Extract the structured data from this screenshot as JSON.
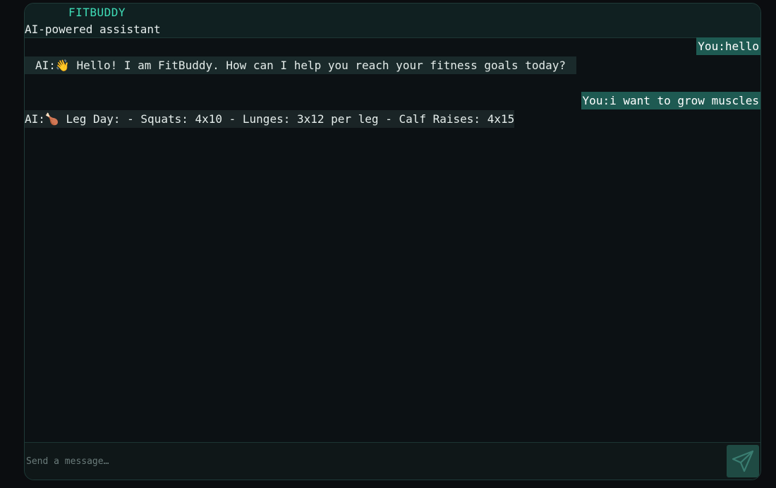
{
  "header": {
    "brand": "FITBUDDY",
    "subtitle": "AI-powered assistant"
  },
  "messages": [
    {
      "role": "user",
      "text": "You:hello"
    },
    {
      "role": "ai",
      "text": "AI:👋 Hello! I am FitBuddy. How can I help you reach your fitness goals today?"
    },
    {
      "role": "user",
      "text": "You:i want to grow muscles"
    },
    {
      "role": "ai",
      "text": "AI:🍗 Leg Day: - Squats: 4x10 - Lunges: 3x12 per leg - Calf Raises: 4x15"
    }
  ],
  "composer": {
    "placeholder": "Send a message…",
    "send_icon": "paper-plane-icon"
  },
  "colors": {
    "accent": "#3fdcb7",
    "user_bubble": "#1e5a52",
    "ai_bubble": "#1a2a2b",
    "background": "#0c1114"
  }
}
